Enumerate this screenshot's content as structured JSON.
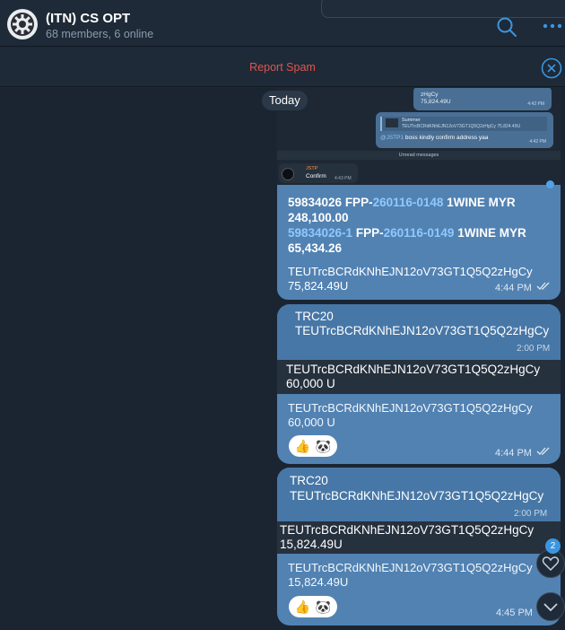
{
  "header": {
    "title": "(ITN) CS OPT",
    "subtitle": "68 members, 6 online"
  },
  "spam_bar": {
    "label": "Report Spam"
  },
  "date_chip": "Today",
  "screenshot_message": {
    "mini_top": {
      "line1": "zHgCy",
      "line2": "75,824.49U",
      "time": "4:42 PM"
    },
    "mini_reply": {
      "quote_name": "Summer",
      "quote_text": "TEUTrcBCRdKNhEJN12oV73GT1Q5Q2zHgCy 75,824.49U",
      "mention": "@JSTP1",
      "text": " boss kindly confirm address yaa",
      "time": "4:42 PM"
    },
    "unread_label": "Unread messages",
    "mini_confirm": {
      "name": "JSTP",
      "text": "Confirm",
      "time": "4:43 PM"
    },
    "line1_a": "59834026 FPP-",
    "line1_link": "260116-0148",
    "line1_b": " 1WINE MYR",
    "line2": "248,100.00",
    "line3_link1": "59834026-1",
    "line3_a": " FPP-",
    "line3_link2": "260116-0149",
    "line3_b": " 1WINE MYR",
    "line4": "65,434.26",
    "addr": "TEUTrcBCRdKNhEJN12oV73GT1Q5Q2zHgCy",
    "amount": "75,824.49U",
    "time": "4:44 PM"
  },
  "reply1": {
    "quote_title": "TRC20",
    "quote_addr": "TEUTrcBCRdKNhEJN12oV73GT1Q5Q2zHgCy",
    "quote_time": "2:00 PM",
    "sub_addr": "TEUTrcBCRdKNhEJN12oV73GT1Q5Q2zHgCy",
    "sub_amount": "60,000 U",
    "addr": "TEUTrcBCRdKNhEJN12oV73GT1Q5Q2zHgCy",
    "amount": "60,000 U",
    "time": "4:44 PM"
  },
  "reply2": {
    "quote_title": "TRC20",
    "quote_addr": "TEUTrcBCRdKNhEJN12oV73GT1Q5Q2zHgCy",
    "quote_time": "2:00 PM",
    "sub_addr": "TEUTrcBCRdKNhEJN12oV73GT1Q5Q2zHgCy",
    "sub_amount": "15,824.49U",
    "addr": "TEUTrcBCRdKNhEJN12oV73GT1Q5Q2zHgCy",
    "amount": "15,824.49U",
    "time": "4:45 PM"
  },
  "reactions": {
    "thumbs": "👍",
    "second": "🐼"
  },
  "unread_badge": "2",
  "icons": {
    "avatar": "gear-icon",
    "search": "search-icon",
    "more": "more-dots-icon",
    "close": "close-circle-icon",
    "read": "double-check-icon",
    "heart": "heart-icon",
    "scroll_down": "chevron-down-icon"
  },
  "colors": {
    "accent": "#3b96df",
    "bubble": "#5282b2",
    "spam": "#e1544c",
    "link": "#8fc8ff"
  }
}
